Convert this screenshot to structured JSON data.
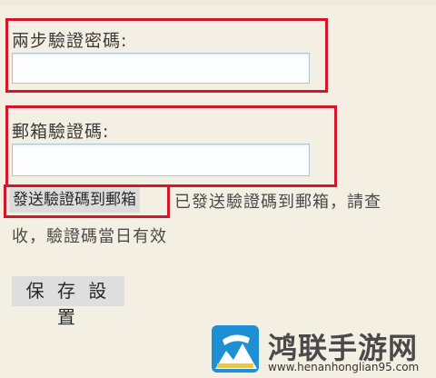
{
  "form": {
    "two_step_label": "兩步驗證密碼:",
    "two_step_value": "",
    "email_code_label": "郵箱驗證碼:",
    "email_code_value": "",
    "send_code_button": "發送驗證碼到郵箱",
    "status_line_1": "已發送驗證碼到郵箱，請查",
    "status_line_2": "收，驗證碼當日有效",
    "save_button": "保 存 設 置"
  },
  "watermark": {
    "title": "鸿联手游网",
    "url": "www.henanhonglian95.com"
  },
  "colors": {
    "highlight": "#d2162b",
    "page_background": "#f3efe2",
    "input_border": "#aec7d7",
    "button_background": "#dcdcdc"
  }
}
